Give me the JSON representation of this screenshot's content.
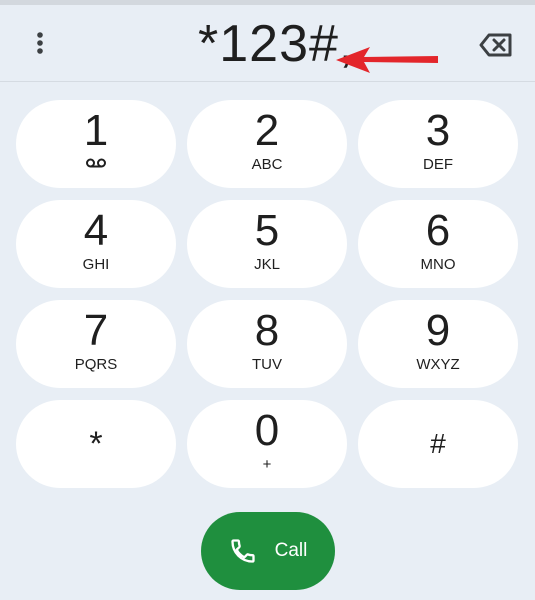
{
  "dialer": {
    "number": "*123#,",
    "menu_icon": "more-vert-icon",
    "backspace_icon": "backspace-icon",
    "annotation_color": "#e3262b"
  },
  "keypad": {
    "keys": [
      {
        "digit": "1",
        "letters": "",
        "icon": "voicemail-icon"
      },
      {
        "digit": "2",
        "letters": "ABC"
      },
      {
        "digit": "3",
        "letters": "DEF"
      },
      {
        "digit": "4",
        "letters": "GHI"
      },
      {
        "digit": "5",
        "letters": "JKL"
      },
      {
        "digit": "6",
        "letters": "MNO"
      },
      {
        "digit": "7",
        "letters": "PQRS"
      },
      {
        "digit": "8",
        "letters": "TUV"
      },
      {
        "digit": "9",
        "letters": "WXYZ"
      },
      {
        "digit": "*",
        "letters": ""
      },
      {
        "digit": "0",
        "letters": "+"
      },
      {
        "digit": "#",
        "letters": ""
      }
    ]
  },
  "call": {
    "label": "Call",
    "icon": "phone-icon",
    "color": "#1f8f3e"
  }
}
